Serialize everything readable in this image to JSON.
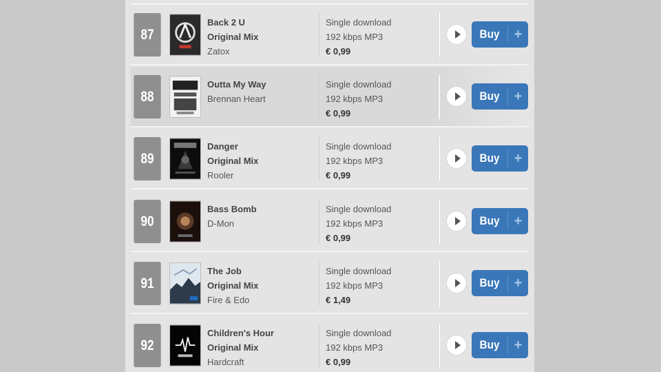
{
  "tracks": [
    {
      "rank": "87",
      "title": "Back 2 U",
      "mix": "Original Mix",
      "artist": "Zatox",
      "format": "Single download",
      "quality": "192 kbps MP3",
      "price": "€ 0,99",
      "buy_label": "Buy"
    },
    {
      "rank": "88",
      "title": "Outta My Way",
      "mix": "",
      "artist": "Brennan Heart",
      "format": "Single download",
      "quality": "192 kbps MP3",
      "price": "€ 0,99",
      "buy_label": "Buy"
    },
    {
      "rank": "89",
      "title": "Danger",
      "mix": "Original Mix",
      "artist": "Rooler",
      "format": "Single download",
      "quality": "192 kbps MP3",
      "price": "€ 0,99",
      "buy_label": "Buy"
    },
    {
      "rank": "90",
      "title": "Bass Bomb",
      "mix": "",
      "artist": "D-Mon",
      "format": "Single download",
      "quality": "192 kbps MP3",
      "price": "€ 0,99",
      "buy_label": "Buy"
    },
    {
      "rank": "91",
      "title": "The Job",
      "mix": "Original Mix",
      "artist": "Fire & Edo",
      "format": "Single download",
      "quality": "192 kbps MP3",
      "price": "€ 1,49",
      "buy_label": "Buy"
    },
    {
      "rank": "92",
      "title": "Children's Hour",
      "mix": "Original Mix",
      "artist": "Hardcraft",
      "format": "Single download",
      "quality": "192 kbps MP3",
      "price": "€ 0,99",
      "buy_label": "Buy"
    }
  ],
  "buy_plus_icon": "plus-icon",
  "play_icon": "play-icon",
  "colors": {
    "buy_button": "#3a77b8",
    "rank_badge": "#8f8f8f",
    "panel": "#e4e4e4",
    "page_background": "#c9c9c9"
  }
}
